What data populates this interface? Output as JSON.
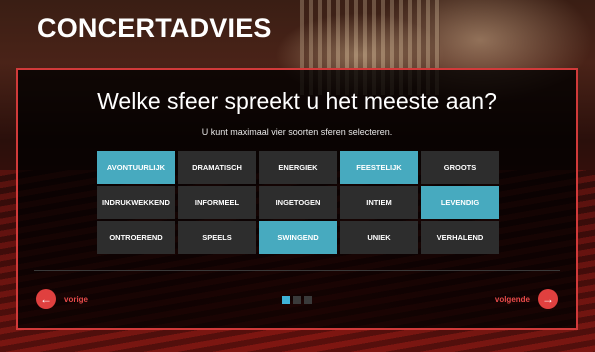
{
  "app": {
    "title": "CONCERTADVIES"
  },
  "question": {
    "title": "Welke sfeer spreekt u het meeste aan?",
    "hint": "U kunt maximaal vier soorten sferen selecteren."
  },
  "options": [
    {
      "label": "AVONTUURLIJK",
      "selected": true
    },
    {
      "label": "DRAMATISCH",
      "selected": false
    },
    {
      "label": "ENERGIEK",
      "selected": false
    },
    {
      "label": "FEESTELIJK",
      "selected": true
    },
    {
      "label": "GROOTS",
      "selected": false
    },
    {
      "label": "INDRUKWEKKEND",
      "selected": false
    },
    {
      "label": "INFORMEEL",
      "selected": false
    },
    {
      "label": "INGETOGEN",
      "selected": false
    },
    {
      "label": "INTIEM",
      "selected": false
    },
    {
      "label": "LEVENDIG",
      "selected": true
    },
    {
      "label": "ONTROEREND",
      "selected": false
    },
    {
      "label": "SPEELS",
      "selected": false
    },
    {
      "label": "SWINGEND",
      "selected": true
    },
    {
      "label": "UNIEK",
      "selected": false
    },
    {
      "label": "VERHALEND",
      "selected": false
    }
  ],
  "navigation": {
    "prev_label": "vorige",
    "next_label": "volgende",
    "prev_icon": "arrow-left-icon",
    "next_icon": "arrow-right-icon"
  },
  "pagination": {
    "total": 3,
    "current": 1
  },
  "colors": {
    "accent_red": "#e0403f",
    "selected_teal": "#47aabf",
    "option_bg": "#2d2d2d"
  }
}
